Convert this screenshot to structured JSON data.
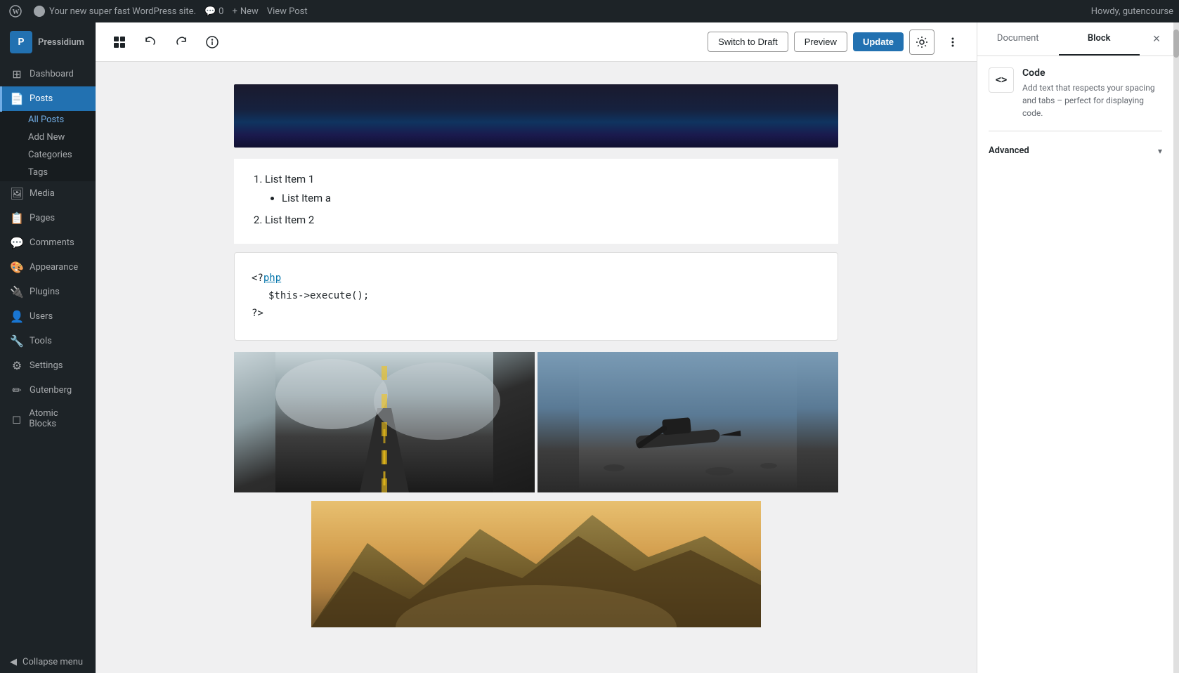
{
  "adminBar": {
    "wpLogo": "W",
    "siteName": "Your new super fast WordPress site.",
    "commentsLabel": "Comments",
    "commentsCount": "0",
    "newLabel": "New",
    "viewPostLabel": "View Post",
    "greetingLabel": "Howdy, gutencourse"
  },
  "sidebar": {
    "brand": "Pressidium",
    "items": [
      {
        "id": "dashboard",
        "label": "Dashboard",
        "icon": "⊞"
      },
      {
        "id": "posts",
        "label": "Posts",
        "icon": "📄",
        "active": true
      },
      {
        "id": "media",
        "label": "Media",
        "icon": "🖼"
      },
      {
        "id": "pages",
        "label": "Pages",
        "icon": "📋"
      },
      {
        "id": "comments",
        "label": "Comments",
        "icon": "💬"
      },
      {
        "id": "appearance",
        "label": "Appearance",
        "icon": "🎨"
      },
      {
        "id": "plugins",
        "label": "Plugins",
        "icon": "🔌"
      },
      {
        "id": "users",
        "label": "Users",
        "icon": "👤"
      },
      {
        "id": "tools",
        "label": "Tools",
        "icon": "🔧"
      },
      {
        "id": "settings",
        "label": "Settings",
        "icon": "⚙"
      },
      {
        "id": "gutenberg",
        "label": "Gutenberg",
        "icon": "✏"
      },
      {
        "id": "atomic-blocks",
        "label": "Atomic Blocks",
        "icon": "◻"
      }
    ],
    "submenu": {
      "posts": [
        {
          "id": "all-posts",
          "label": "All Posts",
          "active": true
        },
        {
          "id": "add-new",
          "label": "Add New"
        },
        {
          "id": "categories",
          "label": "Categories"
        },
        {
          "id": "tags",
          "label": "Tags"
        }
      ]
    },
    "collapseLabel": "Collapse menu"
  },
  "toolbar": {
    "addBlockTitle": "Add block",
    "undoTitle": "Undo",
    "redoTitle": "Redo",
    "infoTitle": "Block information",
    "switchDraftLabel": "Switch to Draft",
    "previewLabel": "Preview",
    "updateLabel": "Update",
    "settingsTitle": "Settings",
    "moreTitle": "More tools & options"
  },
  "content": {
    "listItems": [
      {
        "text": "List Item 1",
        "subitems": [
          "List Item a"
        ]
      },
      {
        "text": "List Item 2"
      }
    ],
    "codeBlock": {
      "line1": "<?php",
      "line2": "    $this->execute();",
      "line3": "?>"
    }
  },
  "rightPanel": {
    "documentTabLabel": "Document",
    "blockTabLabel": "Block",
    "closeLabel": "×",
    "block": {
      "iconSymbol": "<>",
      "title": "Code",
      "description": "Add text that respects your spacing and tabs – perfect for displaying code."
    },
    "advancedLabel": "Advanced",
    "advancedChevron": "▾"
  }
}
